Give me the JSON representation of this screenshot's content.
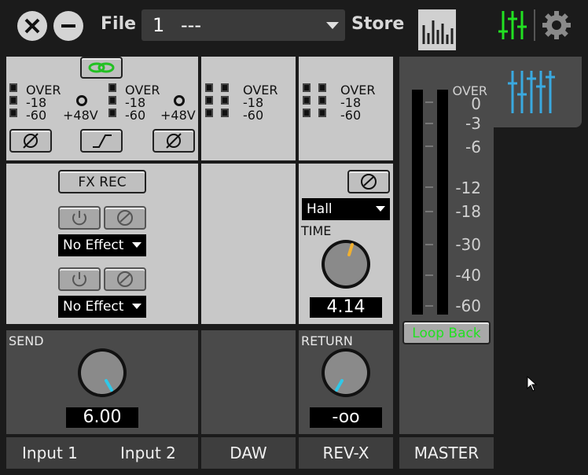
{
  "topbar": {
    "file_label": "File",
    "preset_number": "1",
    "preset_name": "---",
    "store_label": "Store"
  },
  "input": {
    "meter_labels": [
      "OVER",
      "-18",
      "-60"
    ],
    "phantom_label": "+48V",
    "fx_rec_label": "FX REC",
    "effect1": "No Effect",
    "effect2": "No Effect",
    "send_label": "SEND",
    "send_value": "6.00"
  },
  "daw": {
    "meter_labels": [
      "OVER",
      "-18",
      "-60"
    ]
  },
  "revx": {
    "meter_labels": [
      "OVER",
      "-18",
      "-60"
    ],
    "type": "Hall",
    "time_label": "TIME",
    "time_value": "4.14",
    "return_label": "RETURN",
    "return_value": "-oo"
  },
  "master": {
    "scale": [
      "OVER",
      "0",
      "-3",
      "-6",
      "-12",
      "-18",
      "-30",
      "-40",
      "-60"
    ],
    "loopback_label": "Loop Back"
  },
  "channels": {
    "input1": "Input 1",
    "input2": "Input 2",
    "daw": "DAW",
    "revx": "REV-X",
    "master": "MASTER"
  },
  "colors": {
    "accent_green": "#22e022",
    "mixer_icon_blue": "#3aa9e0",
    "knob_cyan": "#30c8e8",
    "knob_orange": "#f0b030"
  }
}
